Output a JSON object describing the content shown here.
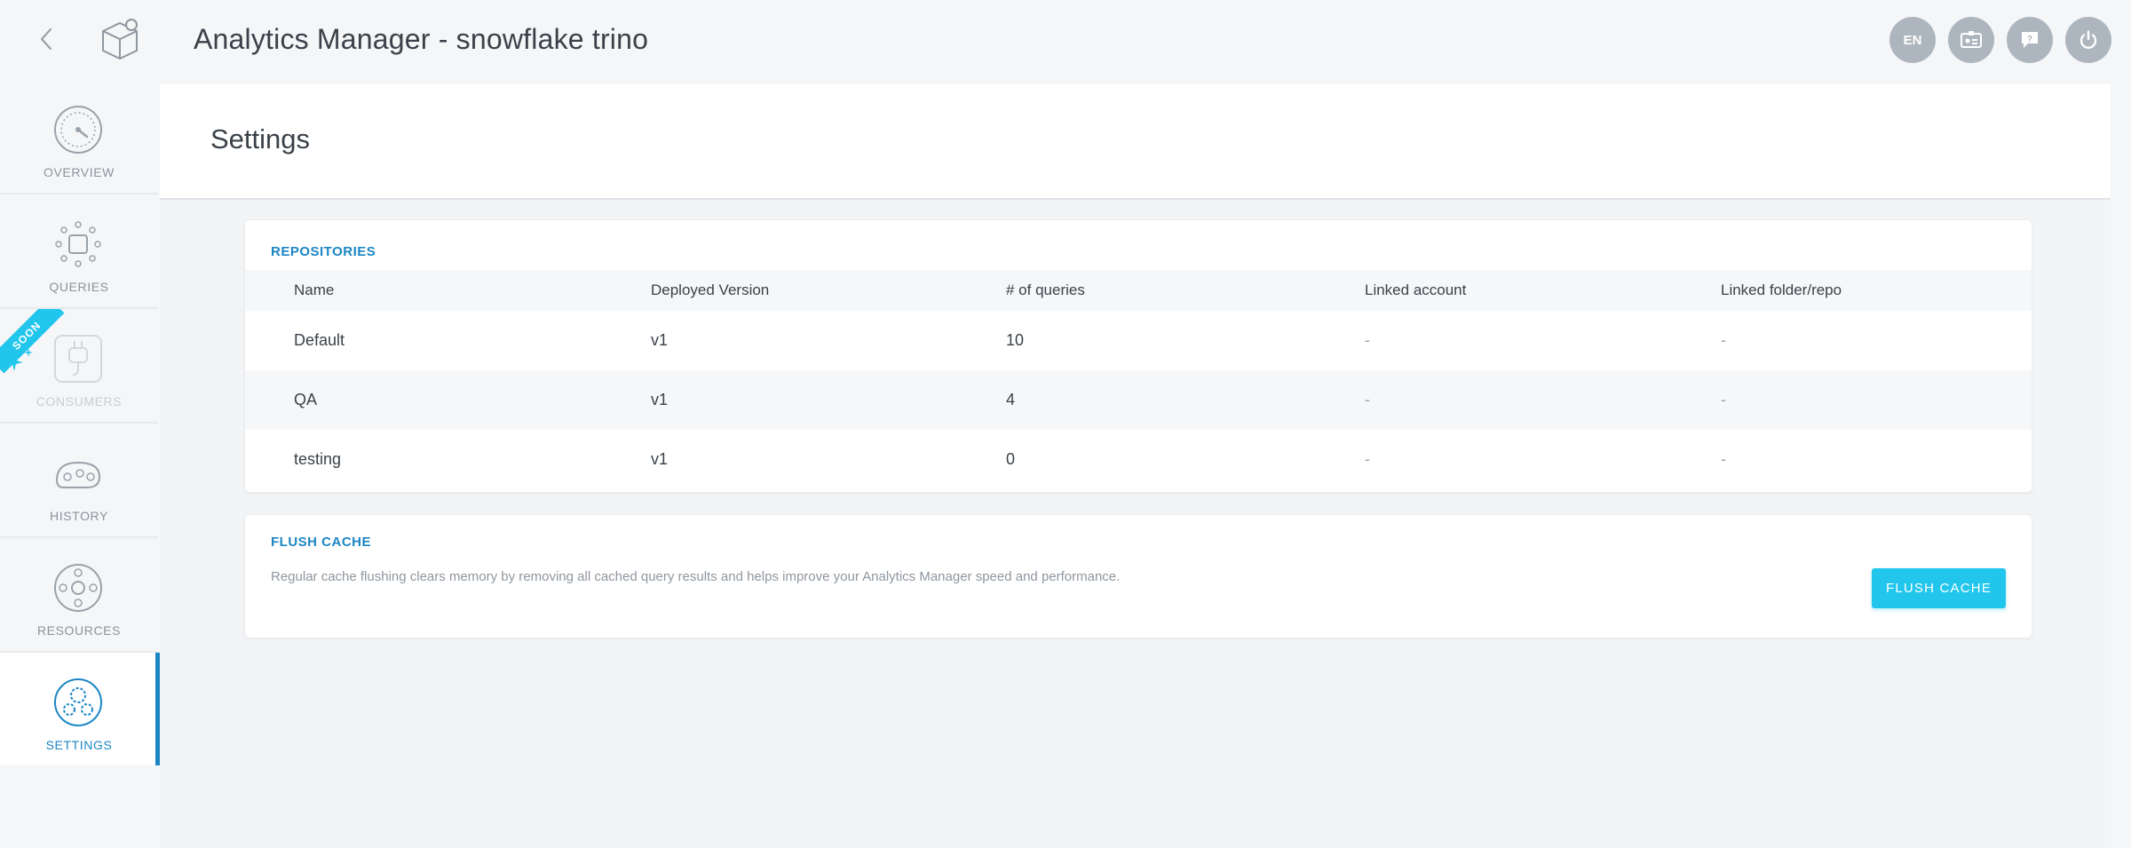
{
  "header": {
    "title": "Analytics Manager - snowflake trino",
    "language": "EN",
    "icons": [
      "chevron-left-icon",
      "app-cube-icon",
      "id-card-icon",
      "chat-help-icon",
      "power-icon"
    ]
  },
  "sidebar": {
    "items": [
      {
        "label": "OVERVIEW",
        "icon": "speedometer-icon",
        "state": "normal"
      },
      {
        "label": "QUERIES",
        "icon": "queries-grid-icon",
        "state": "normal"
      },
      {
        "label": "CONSUMERS",
        "icon": "plug-icon",
        "state": "disabled",
        "badge": "SOON"
      },
      {
        "label": "HISTORY",
        "icon": "history-timeline-icon",
        "state": "normal"
      },
      {
        "label": "RESOURCES",
        "icon": "resources-icon",
        "state": "normal"
      },
      {
        "label": "SETTINGS",
        "icon": "settings-gear-icon",
        "state": "active"
      }
    ]
  },
  "page": {
    "title": "Settings"
  },
  "repositories": {
    "title": "REPOSITORIES",
    "columns": [
      "Name",
      "Deployed Version",
      "# of queries",
      "Linked account",
      "Linked folder/repo"
    ],
    "rows": [
      [
        "Default",
        "v1",
        "10",
        "-",
        "-"
      ],
      [
        "QA",
        "v1",
        "4",
        "-",
        "-"
      ],
      [
        "testing",
        "v1",
        "0",
        "-",
        "-"
      ]
    ]
  },
  "flush_cache": {
    "title": "FLUSH CACHE",
    "description": "Regular cache flushing clears memory by removing all cached query results and helps improve your Analytics Manager speed and performance.",
    "button_label": "FLUSH CACHE"
  },
  "colors": {
    "accent": "#1b86c4",
    "button": "#22c6ec",
    "icon_button": "#adb6bf"
  }
}
